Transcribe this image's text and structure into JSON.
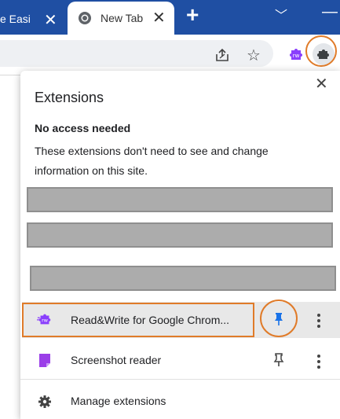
{
  "tabs": {
    "previous": {
      "title": "e Easi",
      "close": "✕"
    },
    "active": {
      "title": "New Tab",
      "close": "✕"
    },
    "new_tab": "+",
    "tab_search": "﹀",
    "minimize": "—"
  },
  "toolbar": {
    "icons": [
      "share-icon",
      "star-icon",
      "readwrite-icon",
      "extensions-puzzle-icon"
    ]
  },
  "panel": {
    "title": "Extensions",
    "close": "✕",
    "section_heading": "No access needed",
    "section_description": "These extensions don't need to see and change information on this site.",
    "extensions": [
      {
        "name": "Read&Write for Google Chrom...",
        "pinned": true,
        "icon": "readwrite-icon"
      },
      {
        "name": "Screenshot reader",
        "pinned": false,
        "icon": "screenshot-reader-icon"
      }
    ],
    "manage_label": "Manage extensions"
  },
  "colors": {
    "tabstrip": "#1f4fa3",
    "highlight": "#e07b29",
    "pin_active": "#1a73e8",
    "readwrite_purple": "#8a3ffc",
    "redaction": "#acacac"
  }
}
